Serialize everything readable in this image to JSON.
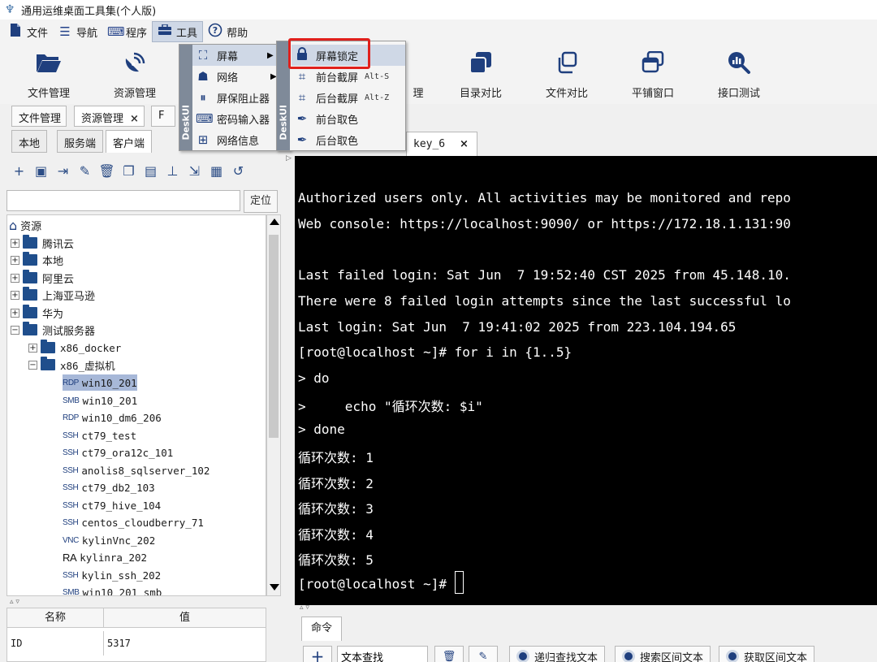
{
  "window": {
    "title": "通用运维桌面工具集(个人版)"
  },
  "menubar": [
    {
      "label": "文件",
      "icon": "file-icon"
    },
    {
      "label": "导航",
      "icon": "hamburger-icon"
    },
    {
      "label": "程序",
      "icon": "keyboard-icon"
    },
    {
      "label": "工具",
      "icon": "toolbox-icon"
    },
    {
      "label": "帮助",
      "icon": "help-icon"
    }
  ],
  "toolbar": {
    "file_manager": "文件管理",
    "resource_manager": "资源管理",
    "hidden_manager": "理",
    "dir_compare": "目录对比",
    "file_compare": "文件对比",
    "tile_window": "平铺窗口",
    "api_test": "接口测试"
  },
  "doctabs": {
    "tab1": "文件管理",
    "tab2": "资源管理",
    "close": "×",
    "tab3_partial": "F"
  },
  "left": {
    "tabs": [
      "本地",
      "服务端",
      "客户端"
    ],
    "locate_button": "定位",
    "search_value": "",
    "tree": {
      "root": "资源",
      "groups": [
        "腾讯云",
        "本地",
        "阿里云",
        "上海亚马逊",
        "华为",
        "测试服务器"
      ],
      "sub": [
        "x86_docker",
        "x86_虚拟机"
      ],
      "leaves": [
        {
          "type": "RDP",
          "name": "win10_201"
        },
        {
          "type": "SMB",
          "name": "win10_201"
        },
        {
          "type": "RDP",
          "name": "win10_dm6_206"
        },
        {
          "type": "SSH",
          "name": "ct79_test"
        },
        {
          "type": "SSH",
          "name": "ct79_ora12c_101"
        },
        {
          "type": "SSH",
          "name": "anolis8_sqlserver_102"
        },
        {
          "type": "SSH",
          "name": "ct79_db2_103"
        },
        {
          "type": "SSH",
          "name": "ct79_hive_104"
        },
        {
          "type": "SSH",
          "name": "centos_cloudberry_71"
        },
        {
          "type": "VNC",
          "name": "kylinVnc_202"
        },
        {
          "type": "RA",
          "name": "kylinra_202"
        },
        {
          "type": "SSH",
          "name": "kylin_ssh_202"
        },
        {
          "type": "SMB",
          "name": "win10_201_smb"
        }
      ]
    },
    "props": {
      "col_name": "名称",
      "col_value": "值",
      "row_key": "ID",
      "row_value": "5317"
    }
  },
  "terminal": {
    "tab_label": "key_6",
    "tab_close": "×",
    "lines": [
      "Authorized users only. All activities may be monitored and repo",
      "Web console: https://localhost:9090/ or https://172.18.1.131:90",
      "",
      "Last failed login: Sat Jun  7 19:52:40 CST 2025 from 45.148.10.",
      "There were 8 failed login attempts since the last successful lo",
      "Last login: Sat Jun  7 19:41:02 2025 from 223.104.194.65",
      "[root@localhost ~]# for i in {1..5}",
      "> do",
      ">     echo \"循环次数: $i\"",
      "> done",
      "循环次数: 1",
      "循环次数: 2",
      "循环次数: 3",
      "循环次数: 4",
      "循环次数: 5",
      "[root@localhost ~]# "
    ]
  },
  "bottom": {
    "tab": "命令",
    "search_value": "文本查找",
    "btn_recursive": "递归查找文本",
    "btn_search_range": "搜索区间文本",
    "btn_get_range": "获取区间文本"
  },
  "tools_menu": {
    "sidebar": "DeskUI",
    "items": [
      "屏幕",
      "网络",
      "屏保阻止器",
      "密码输入器",
      "网络信息"
    ]
  },
  "screen_submenu": {
    "sidebar": "DeskUI",
    "items": [
      {
        "label": "屏幕锁定",
        "shortcut": ""
      },
      {
        "label": "前台截屏",
        "shortcut": "Alt-S"
      },
      {
        "label": "后台截屏",
        "shortcut": "Alt-Z"
      },
      {
        "label": "前台取色",
        "shortcut": ""
      },
      {
        "label": "后台取色",
        "shortcut": ""
      }
    ]
  },
  "colors": {
    "accent": "#1f3f7e",
    "highlight": "#cfd8e6",
    "red_box": "#e0201c",
    "terminal_bg": "#000000"
  }
}
